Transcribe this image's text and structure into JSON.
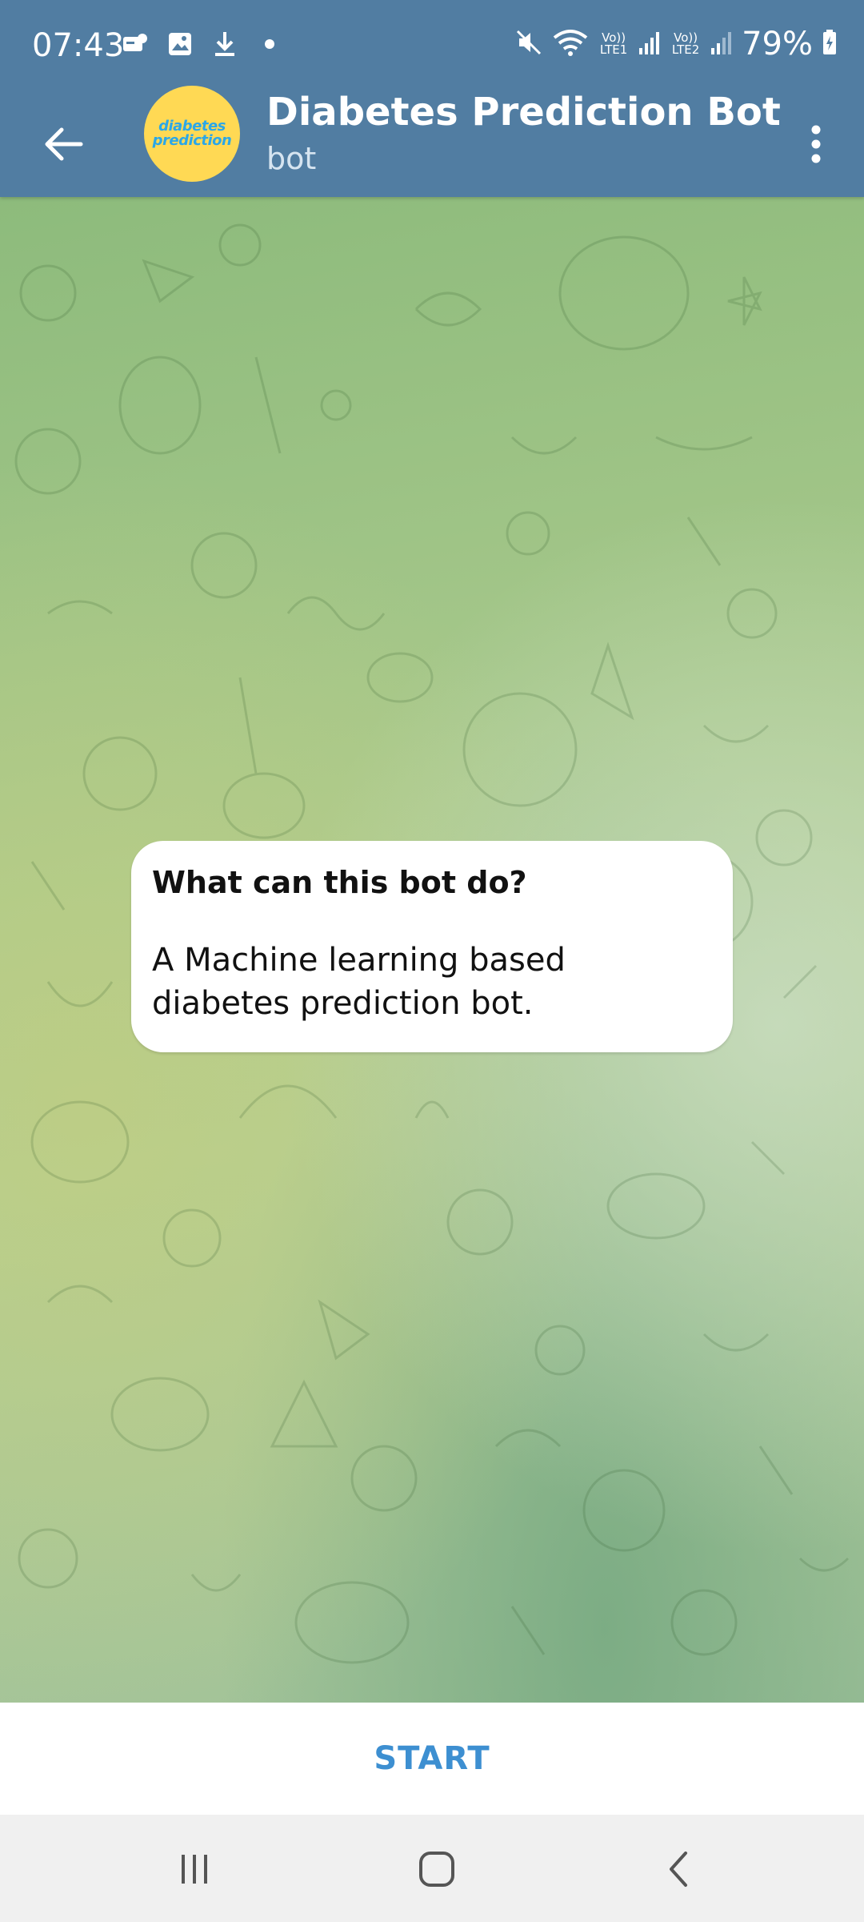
{
  "status": {
    "time": "07:43",
    "lte1": "Vo)) LTE1",
    "lte2": "Vo)) LTE2",
    "battery": "79%"
  },
  "header": {
    "title": "Diabetes Prediction Bot",
    "subtitle": "bot",
    "avatar_text": "diabetes prediction",
    "back_icon": "arrow-left-icon",
    "menu_icon": "more-vert-icon"
  },
  "bubble": {
    "title": "What can this bot do?",
    "body": "A Machine learning based diabetes prediction bot."
  },
  "start": {
    "label": "START"
  },
  "colors": {
    "header": "#517da2",
    "start_text": "#3d8fd1",
    "avatar_bg": "#ffd954",
    "avatar_text": "#2ba7e8"
  },
  "nav": {
    "recents_icon": "recents-icon",
    "home_icon": "home-icon",
    "back_icon": "nav-back-icon"
  }
}
